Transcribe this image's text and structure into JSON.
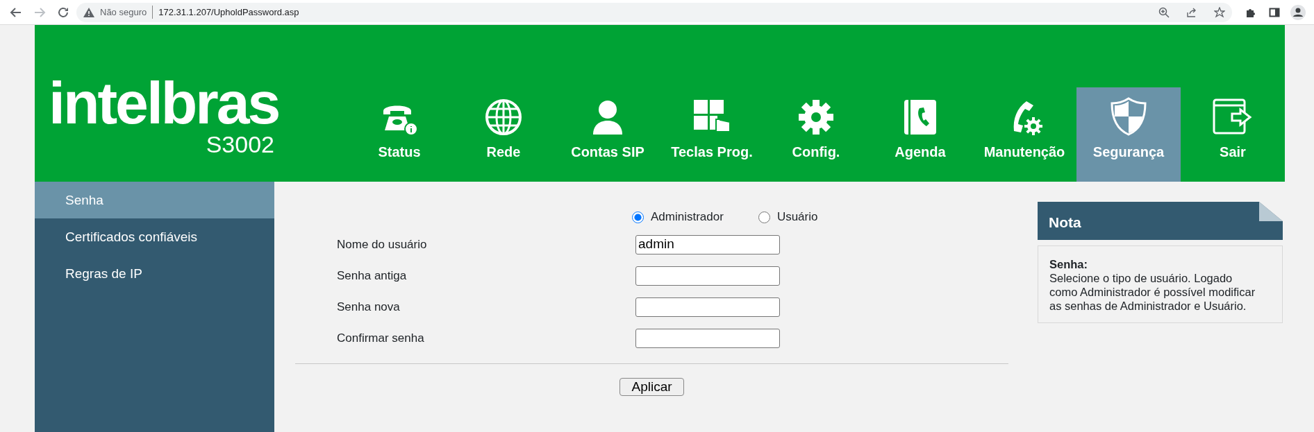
{
  "browser": {
    "security_label": "Não seguro",
    "url": "172.31.1.207/UpholdPassword.asp",
    "forward_disabled": true
  },
  "header": {
    "logo": "intelbras",
    "model": "S3002"
  },
  "nav": [
    {
      "label": "Status",
      "selected": false
    },
    {
      "label": "Rede",
      "selected": false
    },
    {
      "label": "Contas SIP",
      "selected": false
    },
    {
      "label": "Teclas Prog.",
      "selected": false
    },
    {
      "label": "Config.",
      "selected": false
    },
    {
      "label": "Agenda",
      "selected": false
    },
    {
      "label": "Manutenção",
      "selected": false
    },
    {
      "label": "Segurança",
      "selected": true
    },
    {
      "label": "Sair",
      "selected": false
    }
  ],
  "sidebar": {
    "items": [
      {
        "label": "Senha",
        "selected": true
      },
      {
        "label": "Certificados confiáveis",
        "selected": false
      },
      {
        "label": "Regras de IP",
        "selected": false
      }
    ]
  },
  "user_type": [
    {
      "label": "Administrador",
      "selected": true
    },
    {
      "label": "Usuário",
      "selected": false
    }
  ],
  "fields": [
    {
      "label": "Nome do usuário",
      "value": "admin"
    },
    {
      "label": "Senha antiga"
    },
    {
      "label": "Senha nova"
    },
    {
      "label": "Confirmar senha"
    }
  ],
  "apply_button": "Aplicar",
  "note": {
    "title": "Nota",
    "heading": "Senha:",
    "text": "Selecione o tipo de usuário. Logado como Administrador é possível modificar as senhas de Administrador e Usuário."
  }
}
